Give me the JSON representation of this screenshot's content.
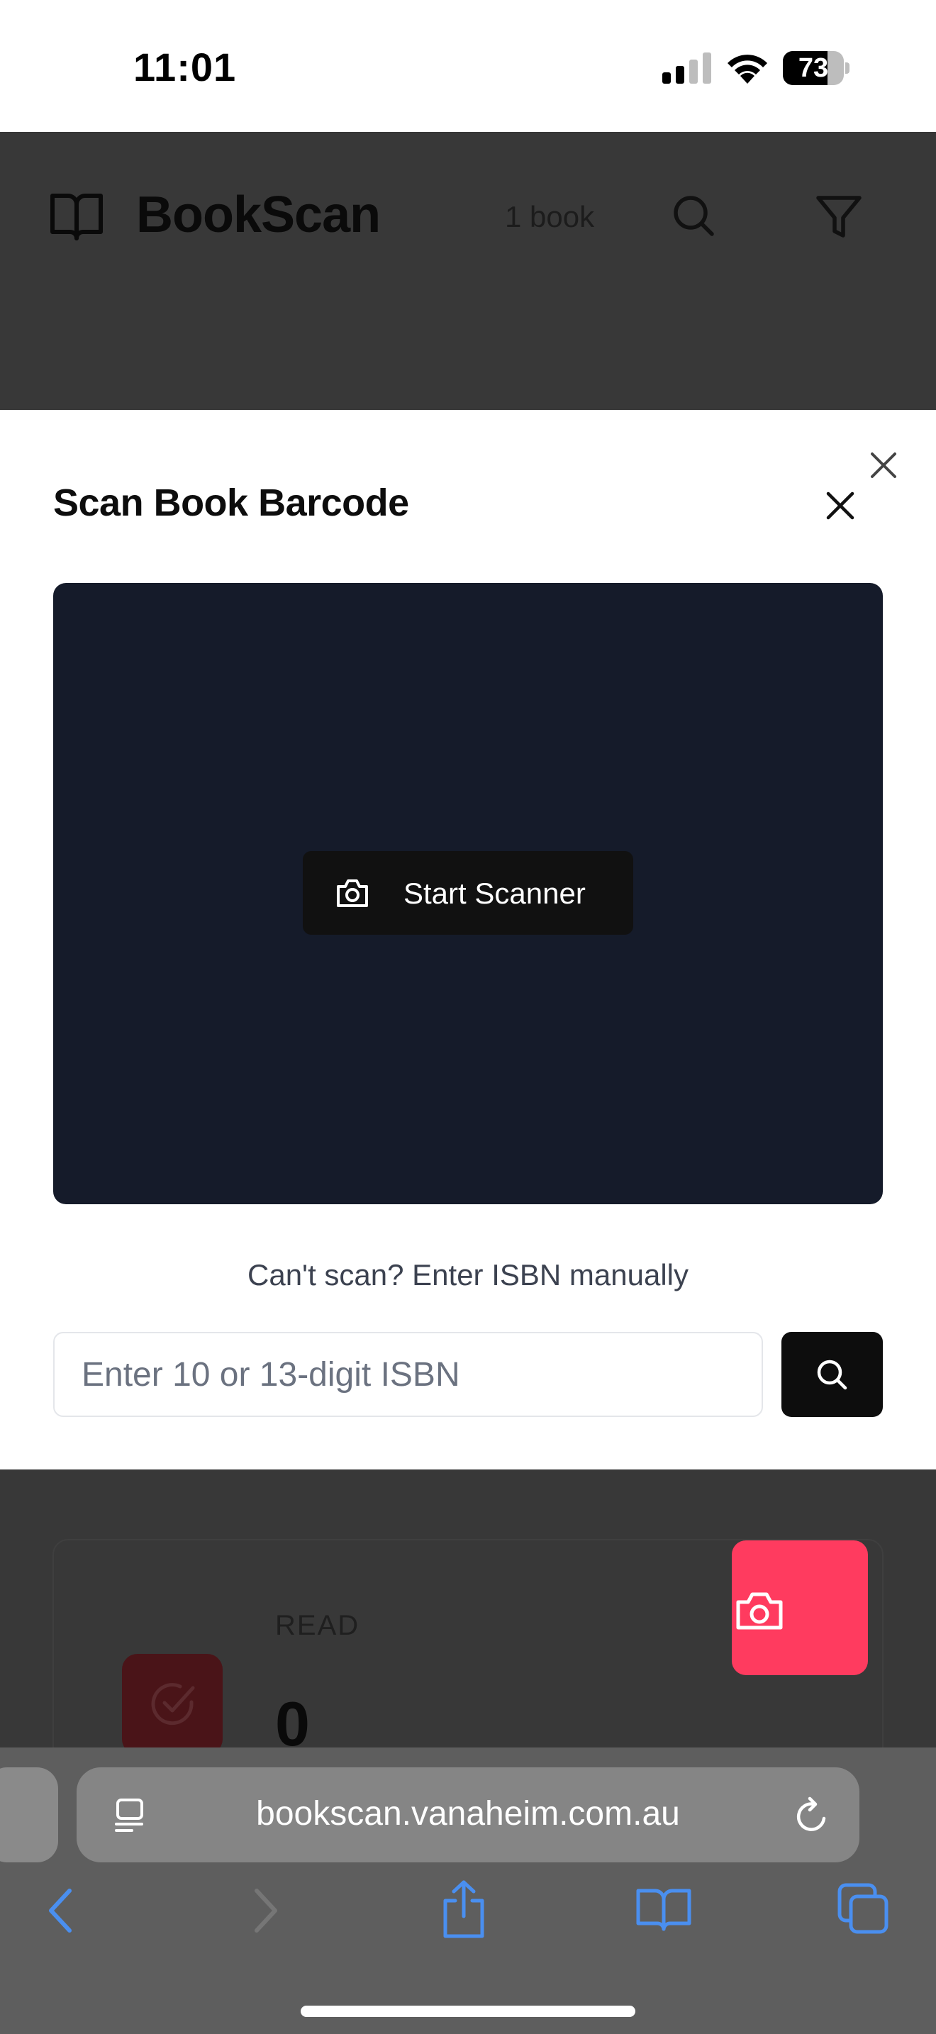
{
  "status_bar": {
    "time": "11:01",
    "battery_percent": "73",
    "battery_level": 0.73,
    "icons": [
      "cellular-signal-icon",
      "wifi-icon",
      "battery-icon"
    ]
  },
  "app_header": {
    "title": "BookScan",
    "book_count": "1 book",
    "icons": [
      "book-open-icon",
      "search-icon",
      "filter-icon"
    ]
  },
  "modal": {
    "title": "Scan Book Barcode",
    "start_scanner_label": "Start Scanner",
    "manual_entry_label": "Can't scan? Enter ISBN manually",
    "isbn_placeholder": "Enter 10 or 13-digit ISBN",
    "isbn_value": ""
  },
  "stats": {
    "read_label": "READ",
    "read_value": "0"
  },
  "browser": {
    "url": "bookscan.vanaheim.com.au"
  },
  "colors": {
    "accent": "#ff3b5f",
    "scanner_bg": "#151b2a",
    "safari_blue": "#4a8ff0",
    "overlay": "#383838"
  }
}
